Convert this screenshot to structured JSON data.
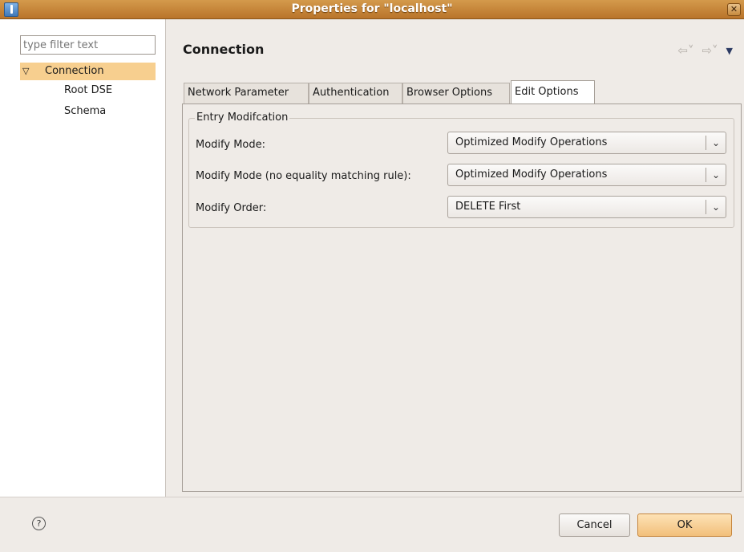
{
  "window": {
    "title": "Properties for \"localhost\"",
    "close_glyph": "✕"
  },
  "sidebar": {
    "filter_placeholder": "type filter text",
    "tree": {
      "expand_glyph": "▽",
      "root": "Connection",
      "children": [
        "Root DSE",
        "Schema"
      ]
    }
  },
  "header": {
    "title": "Connection",
    "back_glyph": "⇦˅",
    "forward_glyph": "⇨˅",
    "menu_glyph": "▼"
  },
  "tabs": [
    {
      "label": "Network Parameter",
      "active": false
    },
    {
      "label": "Authentication",
      "active": false
    },
    {
      "label": "Browser Options",
      "active": false
    },
    {
      "label": "Edit Options",
      "active": true
    }
  ],
  "group": {
    "title": "Entry Modifcation",
    "rows": [
      {
        "label": "Modify Mode:",
        "value": "Optimized Modify Operations"
      },
      {
        "label": "Modify Mode (no equality matching rule):",
        "value": "Optimized Modify Operations"
      },
      {
        "label": "Modify Order:",
        "value": "DELETE First"
      }
    ],
    "combo_arrow_glyph": "⌄"
  },
  "footer": {
    "help_glyph": "?",
    "cancel_label": "Cancel",
    "ok_label": "OK"
  },
  "colors": {
    "titlebar": "#c98538",
    "selection": "#f7cf8f",
    "ok_button": "#f2bf7a"
  }
}
